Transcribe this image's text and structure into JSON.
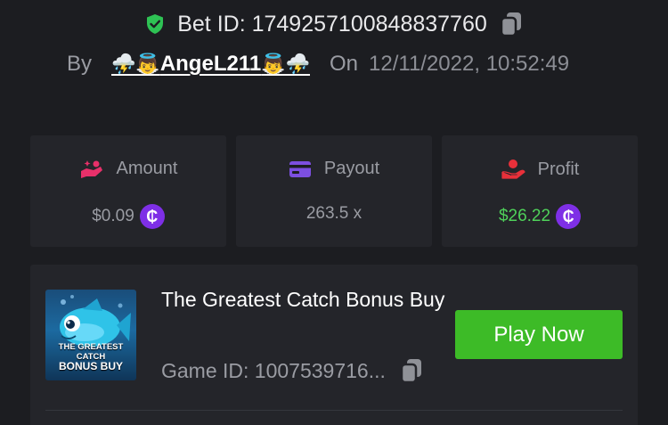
{
  "bet": {
    "label": "Bet ID:",
    "id": "1749257100848837760",
    "verified_icon": "shield-check-icon",
    "copy_icon": "copy-icon"
  },
  "author": {
    "by_label": "By",
    "prefix_emoji": "⛈️👼",
    "username": "AngeL211",
    "suffix_emoji": "👼⛈️",
    "on_label": "On",
    "date": "12/11/2022, 10:52:49"
  },
  "stats": [
    {
      "label": "Amount",
      "value": "$0.09",
      "icon": "hand-coin-icon",
      "coin": "currency-coin-icon"
    },
    {
      "label": "Payout",
      "value": "263.5 x",
      "icon": "card-icon"
    },
    {
      "label": "Profit",
      "value": "$26.22",
      "icon": "profit-hand-icon",
      "coin": "currency-coin-icon"
    }
  ],
  "coin_symbol": "₵",
  "game": {
    "title": "The Greatest Catch Bonus Buy",
    "id_text": "Game ID: 1007539716...",
    "thumb_line1": "THE GREATEST CATCH",
    "thumb_line2": "BONUS BUY",
    "play_label": "Play Now"
  },
  "colors": {
    "background": "#1c1d21",
    "card": "#24252a",
    "accent_green": "#3dbb27",
    "profit_green": "#4fd15a",
    "coin_purple": "#7e2fe6",
    "amount_pink": "#e8306a",
    "payout_purple": "#7c4fe0",
    "profit_red": "#e8303a"
  }
}
